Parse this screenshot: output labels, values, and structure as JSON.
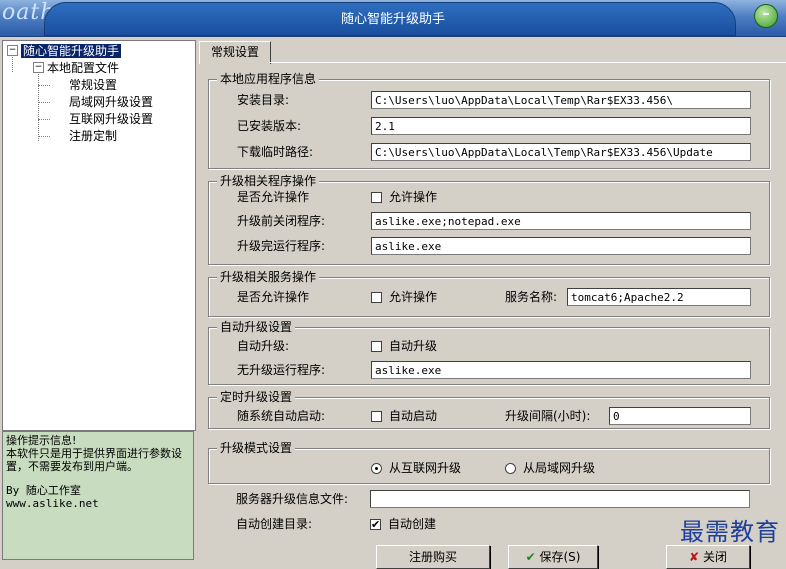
{
  "window": {
    "logo": "oath",
    "title": "随心智能升级助手",
    "min_btn": "–"
  },
  "tree": {
    "root": "随心智能升级助手",
    "config": "本地配置文件",
    "items": [
      "常规设置",
      "局域网升级设置",
      "互联网升级设置",
      "注册定制"
    ]
  },
  "info": {
    "lines": [
      "操作提示信息!",
      "本软件只是用于提供界面进行参数设置，不需要发布到用户端。"
    ],
    "by": "By 随心工作室",
    "site": "www.aslike.net"
  },
  "tab": {
    "label": "常规设置"
  },
  "groups": {
    "local": {
      "title": "本地应用程序信息",
      "install_dir_label": "安装目录:",
      "install_dir": "C:\\Users\\luo\\AppData\\Local\\Temp\\Rar$EX33.456\\",
      "version_label": "已安装版本:",
      "version": "2.1",
      "temp_label": "下载临时路径:",
      "temp": "C:\\Users\\luo\\AppData\\Local\\Temp\\Rar$EX33.456\\Update"
    },
    "program": {
      "title": "升级相关程序操作",
      "allow_label": "是否允许操作",
      "allow_chk": "允许操作",
      "allow_checked": false,
      "close_label": "升级前关闭程序:",
      "close_value": "aslike.exe;notepad.exe",
      "run_label": "升级完运行程序:",
      "run_value": "aslike.exe"
    },
    "service": {
      "title": "升级相关服务操作",
      "allow_label": "是否允许操作",
      "allow_chk": "允许操作",
      "allow_checked": false,
      "name_label": "服务名称:",
      "name_value": "tomcat6;Apache2.2"
    },
    "auto": {
      "title": "自动升级设置",
      "auto_label": "自动升级:",
      "auto_chk": "自动升级",
      "auto_checked": false,
      "noupd_label": "无升级运行程序:",
      "noupd_value": "aslike.exe"
    },
    "timer": {
      "title": "定时升级设置",
      "start_label": "随系统自动启动:",
      "start_chk": "自动启动",
      "start_checked": false,
      "interval_label": "升级间隔(小时):",
      "interval_value": "0"
    },
    "mode": {
      "title": "升级模式设置",
      "internet": "从互联网升级",
      "lan": "从局域网升级",
      "selected": "internet"
    }
  },
  "server": {
    "label": "服务器升级信息文件:",
    "value": "",
    "mkdir_label": "自动创建目录:",
    "mkdir_chk": "自动创建",
    "mkdir_checked": true
  },
  "buttons": {
    "register": "注册购买",
    "save": "保存(S)",
    "close": "关闭"
  },
  "watermark": "最需教育"
}
